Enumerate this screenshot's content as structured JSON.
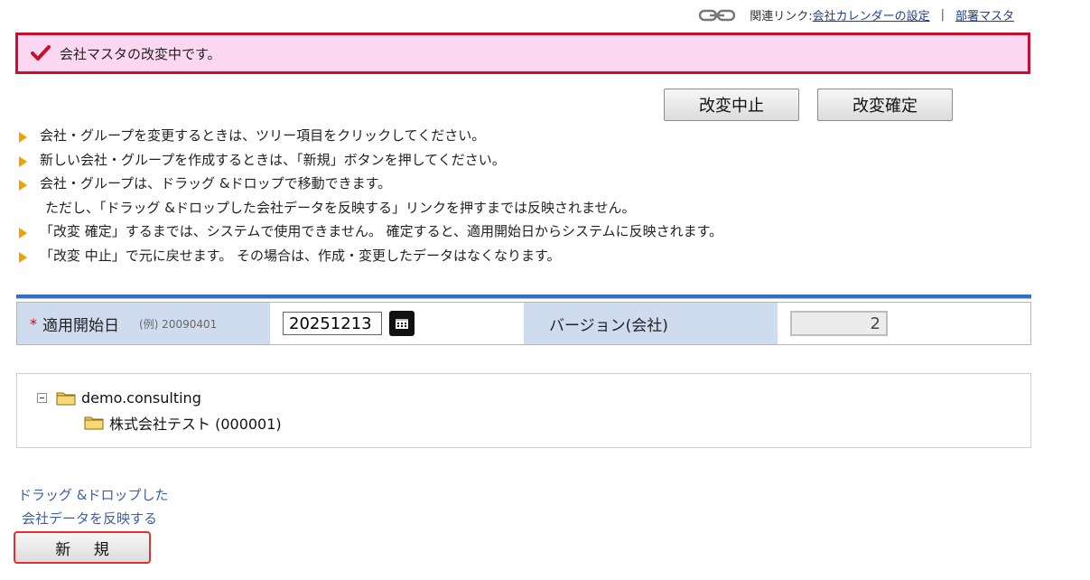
{
  "related": {
    "label": "関連リンク:",
    "links": [
      "会社カレンダーの設定",
      "部署マスタ"
    ],
    "separator": "|",
    "icon": "chain-link-icon"
  },
  "notice": {
    "icon": "checkmark-icon",
    "message": "会社マスタの改変中です。",
    "border_color": "#c8102e",
    "background": "#fcd7f1"
  },
  "buttons": {
    "cancel": "改変中止",
    "confirm": "改変確定",
    "new": "新 規"
  },
  "instructions": [
    "会社・グループを変更するときは、ツリー項目をクリックしてください。",
    "新しい会社・グループを作成するときは、「新規」ボタンを押してください。",
    "会社・グループは、ドラッグ &ドロップで移動できます。",
    "ただし、「ドラッグ &ドロップした会社データを反映する」リンクを押すまでは反映されません。",
    "「改変 確定」するまでは、システムで使用できません。 確定すると、適用開始日からシステムに反映されます。",
    "「改変 中止」で元に戻せます。 その場合は、作成・変更したデータはなくなります。"
  ],
  "form": {
    "required_mark": "*",
    "date_label": "適用開始日",
    "date_example": "(例) 20090401",
    "date_value": "20251213",
    "calendar_icon": "calendar-icon",
    "version_label": "バージョン(会社)",
    "version_value": "2"
  },
  "tree": {
    "root": {
      "label": "demo.consulting",
      "icon": "folder-icon",
      "toggle": "collapse-minus-icon"
    },
    "children": [
      {
        "label": "株式会社テスト (000001)",
        "icon": "folder-icon"
      }
    ]
  },
  "dnd_link": {
    "line1": "ドラッグ &ドロップした",
    "line2": "会社データを反映する"
  },
  "colors": {
    "accent_blue": "#2f6fc8",
    "label_bg": "#cfdcef",
    "bullet": "#f0a000",
    "required": "#e00000"
  }
}
